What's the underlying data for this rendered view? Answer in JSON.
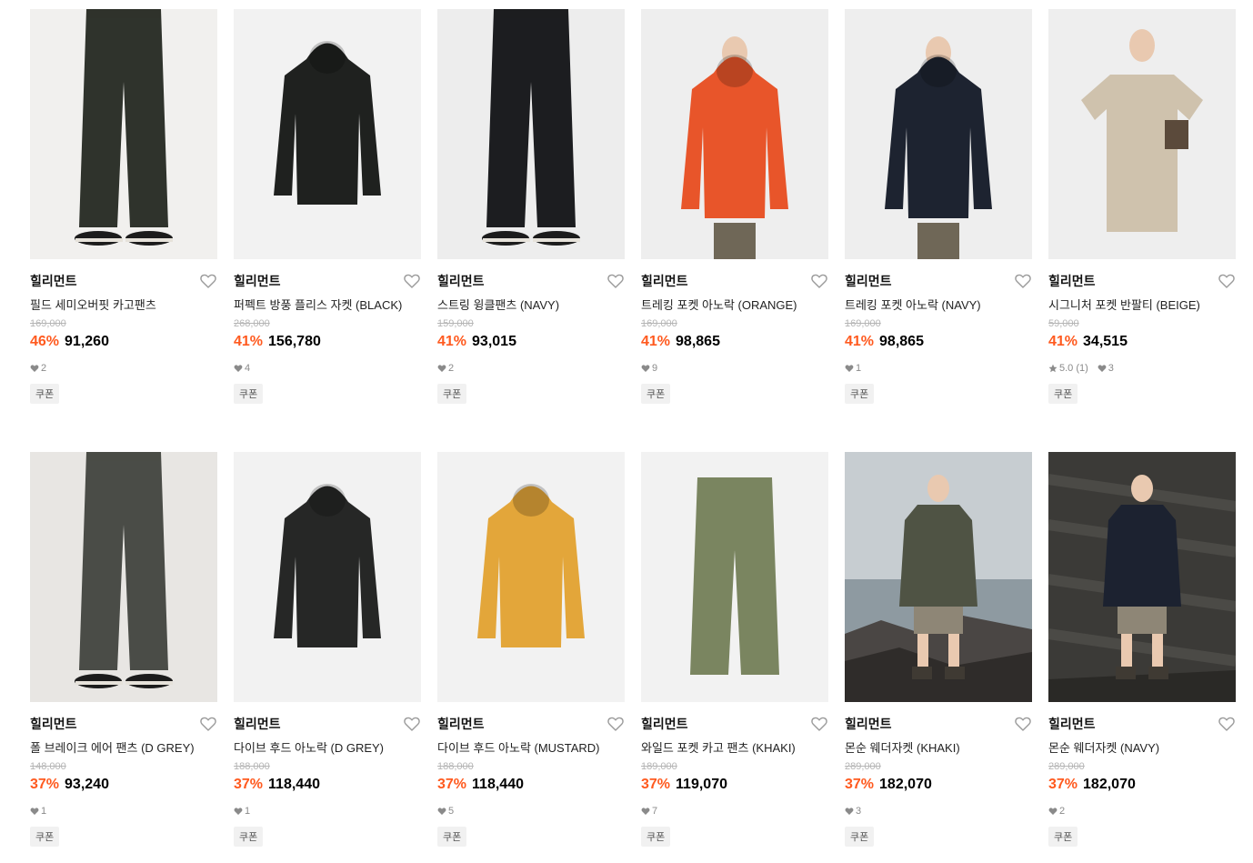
{
  "products": [
    {
      "brand": "힐리먼트",
      "name": "필드 세미오버핏 카고팬츠",
      "original_price": "169,000",
      "discount": "46%",
      "price": "91,260",
      "likes": "2",
      "rating": "",
      "coupon": "쿠폰",
      "bg": "#f1f0ee",
      "garment": "pants",
      "color": "#2f332c",
      "hasModel": true,
      "photo": "studio"
    },
    {
      "brand": "힐리먼트",
      "name": "퍼펙트 방풍 플리스 자켓 (BLACK)",
      "original_price": "268,000",
      "discount": "41%",
      "price": "156,780",
      "likes": "4",
      "rating": "",
      "coupon": "쿠폰",
      "bg": "#f2f2f2",
      "garment": "jacket",
      "color": "#1f211f",
      "hasModel": false,
      "photo": "studio"
    },
    {
      "brand": "힐리먼트",
      "name": "스트링 윙클팬츠 (NAVY)",
      "original_price": "159,000",
      "discount": "41%",
      "price": "93,015",
      "likes": "2",
      "rating": "",
      "coupon": "쿠폰",
      "bg": "#ededed",
      "garment": "pants",
      "color": "#1c1d20",
      "hasModel": true,
      "photo": "studio"
    },
    {
      "brand": "힐리먼트",
      "name": "트레킹 포켓 아노락 (ORANGE)",
      "original_price": "169,000",
      "discount": "41%",
      "price": "98,865",
      "likes": "9",
      "rating": "",
      "coupon": "쿠폰",
      "bg": "#eeeeee",
      "garment": "anorak",
      "color": "#e8552a",
      "hasModel": true,
      "photo": "studio"
    },
    {
      "brand": "힐리먼트",
      "name": "트레킹 포켓 아노락 (NAVY)",
      "original_price": "169,000",
      "discount": "41%",
      "price": "98,865",
      "likes": "1",
      "rating": "",
      "coupon": "쿠폰",
      "bg": "#eeeeee",
      "garment": "anorak",
      "color": "#1d2330",
      "hasModel": true,
      "photo": "studio"
    },
    {
      "brand": "힐리먼트",
      "name": "시그니처 포켓 반팔티 (BEIGE)",
      "original_price": "59,000",
      "discount": "41%",
      "price": "34,515",
      "likes": "3",
      "rating": "5.0 (1)",
      "coupon": "쿠폰",
      "bg": "#eeeeee",
      "garment": "tee",
      "color": "#cfc2ad",
      "hasModel": true,
      "photo": "studio"
    },
    {
      "brand": "힐리먼트",
      "name": "폴 브레이크 에어 팬츠 (D GREY)",
      "original_price": "148,000",
      "discount": "37%",
      "price": "93,240",
      "likes": "1",
      "rating": "",
      "coupon": "쿠폰",
      "bg": "#e8e6e3",
      "garment": "pants",
      "color": "#4a4c47",
      "hasModel": true,
      "photo": "studio"
    },
    {
      "brand": "힐리먼트",
      "name": "다이브 후드 아노락 (D GREY)",
      "original_price": "188,000",
      "discount": "37%",
      "price": "118,440",
      "likes": "1",
      "rating": "",
      "coupon": "쿠폰",
      "bg": "#f2f2f2",
      "garment": "anorak",
      "color": "#262726",
      "hasModel": false,
      "photo": "studio"
    },
    {
      "brand": "힐리먼트",
      "name": "다이브 후드 아노락 (MUSTARD)",
      "original_price": "188,000",
      "discount": "37%",
      "price": "118,440",
      "likes": "5",
      "rating": "",
      "coupon": "쿠폰",
      "bg": "#f2f2f2",
      "garment": "anorak",
      "color": "#e3a63a",
      "hasModel": false,
      "photo": "studio"
    },
    {
      "brand": "힐리먼트",
      "name": "와일드 포켓 카고 팬츠 (KHAKI)",
      "original_price": "189,000",
      "discount": "37%",
      "price": "119,070",
      "likes": "7",
      "rating": "",
      "coupon": "쿠폰",
      "bg": "#f2f2f2",
      "garment": "pants",
      "color": "#7a8560",
      "hasModel": false,
      "photo": "studio"
    },
    {
      "brand": "힐리먼트",
      "name": "몬순 웨더자켓 (KHAKI)",
      "original_price": "289,000",
      "discount": "37%",
      "price": "182,070",
      "likes": "3",
      "rating": "",
      "coupon": "쿠폰",
      "bg": "#b9c0c4",
      "garment": "coat",
      "color": "#4f5344",
      "hasModel": true,
      "photo": "coast"
    },
    {
      "brand": "힐리먼트",
      "name": "몬순 웨더자켓 (NAVY)",
      "original_price": "289,000",
      "discount": "37%",
      "price": "182,070",
      "likes": "2",
      "rating": "",
      "coupon": "쿠폰",
      "bg": "#3a3936",
      "garment": "coat",
      "color": "#1c2230",
      "hasModel": true,
      "photo": "rocks"
    }
  ]
}
